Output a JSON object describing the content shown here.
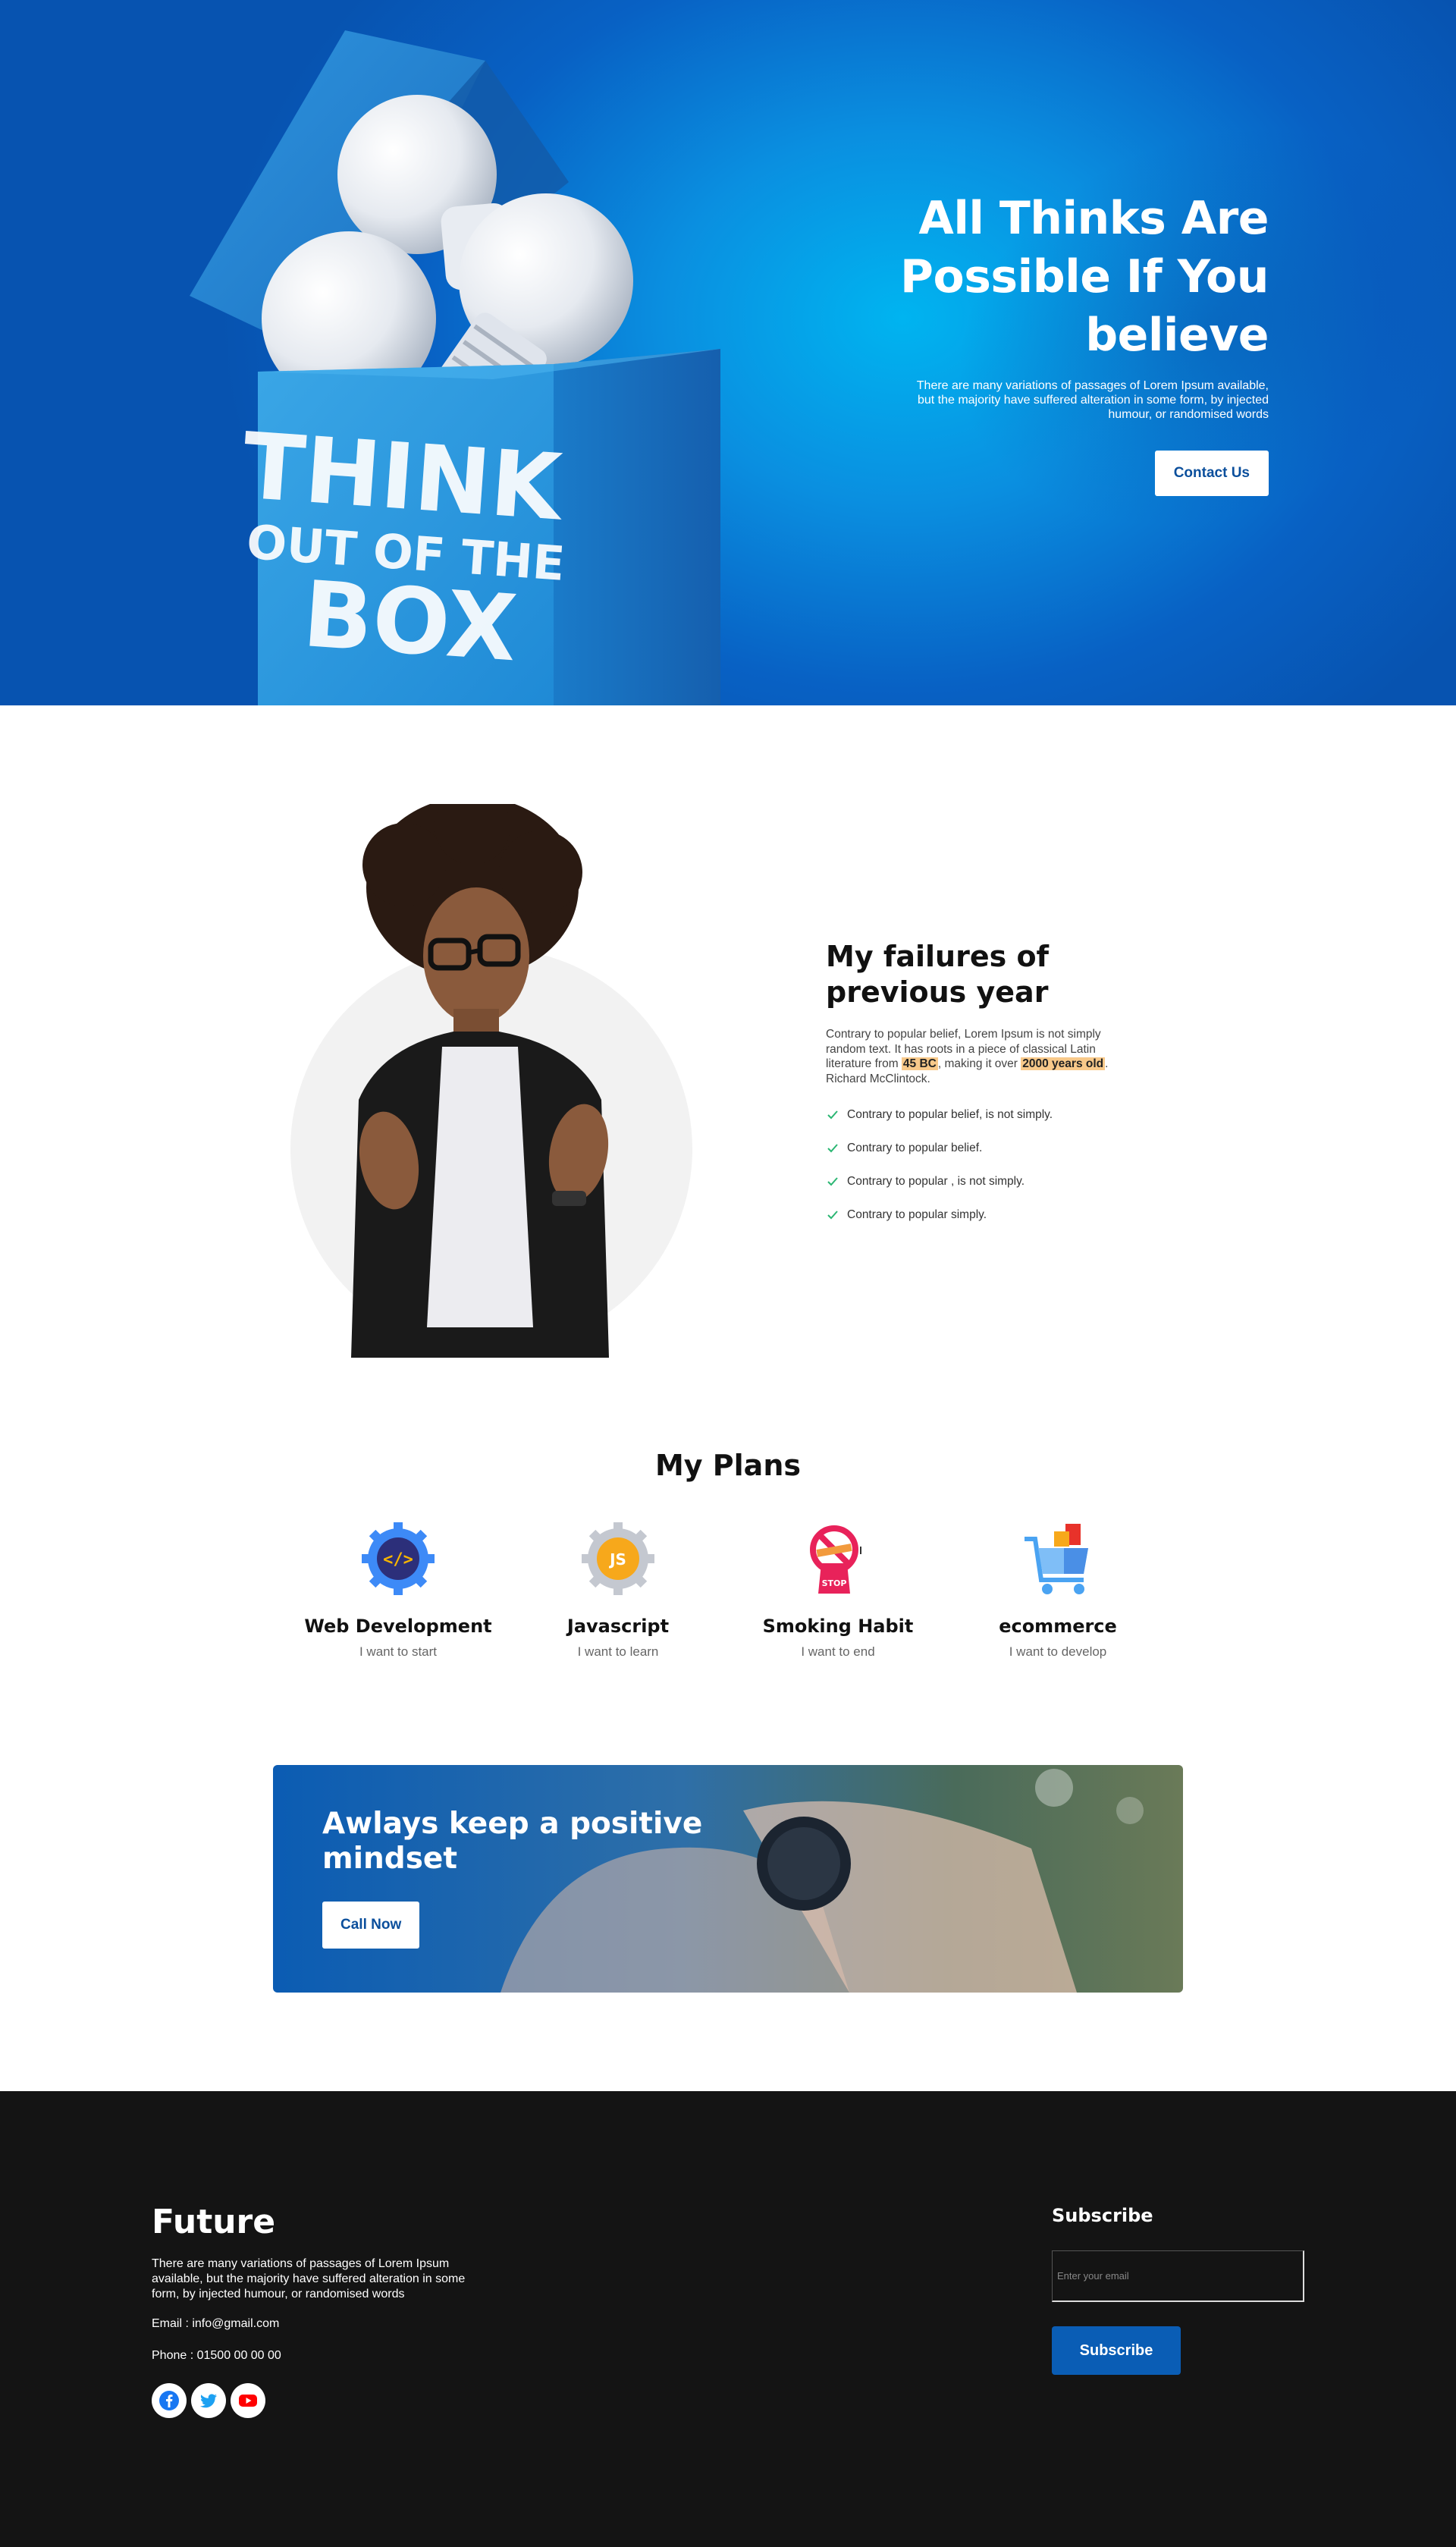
{
  "hero": {
    "title": "All Thinks Are Possible If You believe",
    "text": "There are many variations of passages of Lorem Ipsum available, but the majority have suffered alteration in some form, by injected humour, or randomised words",
    "button": "Contact Us",
    "box_text": {
      "line1": "THINK",
      "line2": "OUT OF THE",
      "line3": "BOX"
    }
  },
  "failures": {
    "title": "My failures of previous year",
    "para_1": "Contrary to popular belief, Lorem Ipsum is not simply random text. It has roots in a piece of classical Latin literature from ",
    "hl_1": "45 BC",
    "para_2": ", making it over ",
    "hl_2": "2000 years old",
    "para_3": ". Richard McClintock.",
    "items": [
      "Contrary to popular belief, is not simply.",
      "Contrary to popular belief.",
      "Contrary to popular , is not simply.",
      "Contrary to popular simply."
    ]
  },
  "plans": {
    "title": "My Plans",
    "items": [
      {
        "name": "Web Development",
        "sub": "I want to start",
        "icon": "code-gear-icon"
      },
      {
        "name": "Javascript",
        "sub": "I want to learn",
        "icon": "js-gear-icon"
      },
      {
        "name": "Smoking Habit",
        "sub": "I want to end",
        "icon": "no-smoking-icon"
      },
      {
        "name": "ecommerce",
        "sub": "I want to develop",
        "icon": "shopping-cart-icon"
      }
    ],
    "js_label": "JS",
    "stop_label": "STOP"
  },
  "cta": {
    "title": "Awlays keep a positive mindset",
    "button": "Call Now"
  },
  "footer": {
    "brand": "Future",
    "text": "There are many variations of passages of Lorem Ipsum available, but the majority have suffered alteration in some form, by injected humour, or randomised words",
    "email": "Email : info@gmail.com",
    "phone": "Phone : 01500 00 00 00",
    "social": [
      "facebook-icon",
      "twitter-icon",
      "youtube-icon"
    ],
    "subscribe_title": "Subscribe",
    "input_placeholder": "Enter your email",
    "subscribe_button": "Subscribe"
  },
  "colors": {
    "hero_blue": "#0861c4",
    "accent_blue": "#0a5db5",
    "highlight": "#f8c98a",
    "check_green": "#2bb673",
    "footer_bg": "#141414"
  }
}
